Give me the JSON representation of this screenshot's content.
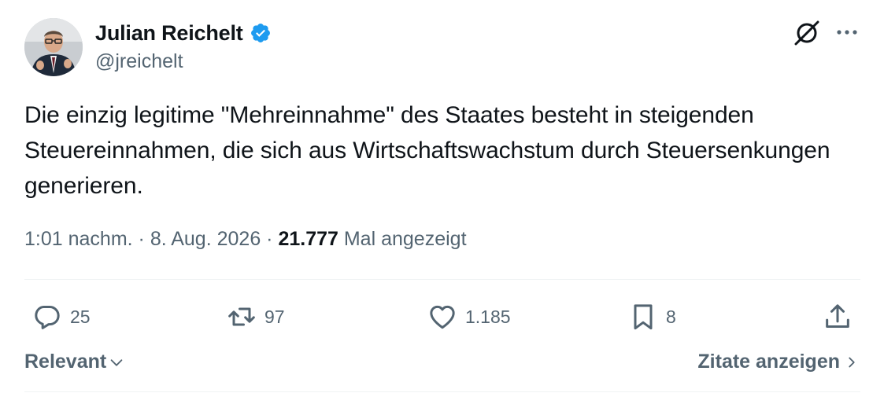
{
  "author": {
    "display_name": "Julian Reichelt",
    "handle": "@jreichelt",
    "verified": true
  },
  "tweet": {
    "text": "Die einzig legitime \"Mehreinnahme\" des Staates besteht in steigenden Steuereinnahmen, die sich aus Wirtschaftswachstum durch Steuersenkungen generieren.",
    "time": "1:01 nachm.",
    "date": "8. Aug. 2026",
    "separator": " · ",
    "views_count": "21.777",
    "views_label": "Mal angezeigt"
  },
  "actions": {
    "reply_count": "25",
    "retweet_count": "97",
    "like_count": "1.185",
    "bookmark_count": "8"
  },
  "footer": {
    "sort_label": "Relevant",
    "quotes_label": "Zitate anzeigen"
  },
  "icons": {
    "verified": "verified-badge-icon",
    "grok": "grok-icon",
    "more": "more-icon",
    "reply": "reply-icon",
    "retweet": "retweet-icon",
    "like": "heart-icon",
    "bookmark": "bookmark-icon",
    "share": "share-icon"
  },
  "colors": {
    "text_primary": "#0f1419",
    "text_secondary": "#536471",
    "verified_blue": "#1d9bf0",
    "divider": "#eff3f4"
  }
}
